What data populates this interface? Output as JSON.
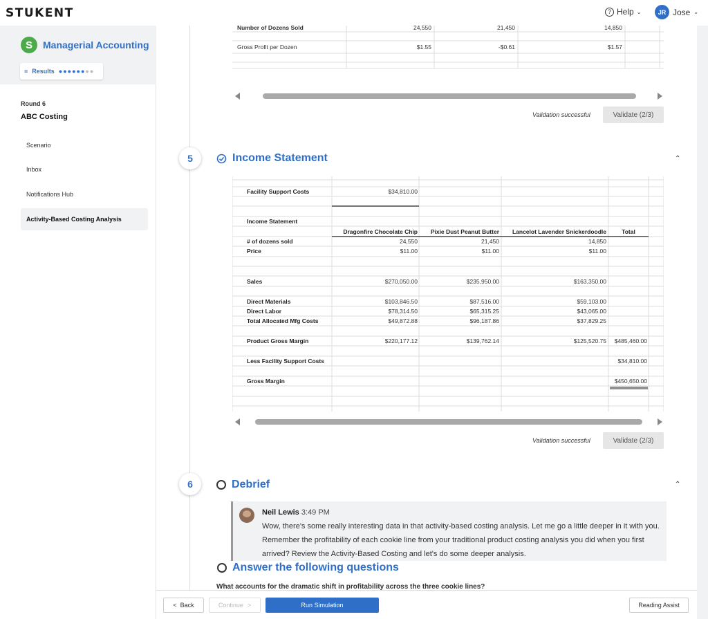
{
  "header": {
    "logo": "STUKENT",
    "help": "Help",
    "user_initials": "JR",
    "user_name": "Jose"
  },
  "sidebar": {
    "course": "Managerial Accounting",
    "course_badge": "S",
    "results": "Results",
    "round": "Round 6",
    "round_name": "ABC Costing",
    "items": [
      {
        "label": "Scenario"
      },
      {
        "label": "Inbox"
      },
      {
        "label": "Notifications Hub"
      },
      {
        "label": "Activity-Based Costing Analysis"
      }
    ]
  },
  "top_table": {
    "rows": [
      {
        "label": "Number of Dozens Sold",
        "values": [
          "24,550",
          "21,450",
          "14,850"
        ]
      },
      {
        "label": "Gross Profit per Dozen",
        "values": [
          "$1.55",
          "-$0.61",
          "$1.57"
        ]
      }
    ],
    "validation": "Validation successful",
    "validate_btn": "Validate (2/3)"
  },
  "step5": {
    "number": "5",
    "title": "Income Statement"
  },
  "income": {
    "facility_label": "Facility Support Costs",
    "facility_value": "$34,810.00",
    "title": "Income Statement",
    "columns": [
      "Dragonfire Chocolate Chip",
      "Pixie Dust Peanut Butter",
      "Lancelot Lavender Snickerdoodle",
      "Total"
    ],
    "rows": [
      {
        "label": "# of dozens sold",
        "values": [
          "24,550",
          "21,450",
          "14,850",
          ""
        ]
      },
      {
        "label": "Price",
        "values": [
          "$11.00",
          "$11.00",
          "$11.00",
          ""
        ]
      },
      {
        "label": "Sales",
        "values": [
          "$270,050.00",
          "$235,950.00",
          "$163,350.00",
          ""
        ]
      },
      {
        "label": "Direct Materials",
        "values": [
          "$103,846.50",
          "$87,516.00",
          "$59,103.00",
          ""
        ]
      },
      {
        "label": "Direct Labor",
        "values": [
          "$78,314.50",
          "$65,315.25",
          "$43,065.00",
          ""
        ]
      },
      {
        "label": "Total Allocated Mfg Costs",
        "values": [
          "$49,872.88",
          "$96,187.86",
          "$37,829.25",
          ""
        ]
      },
      {
        "label": "Product Gross Margin",
        "values": [
          "$220,177.12",
          "$139,762.14",
          "$125,520.75",
          "$485,460.00"
        ]
      },
      {
        "label": "Less Facility Support Costs",
        "values": [
          "",
          "",
          "",
          "$34,810.00"
        ]
      },
      {
        "label": "Gross Margin",
        "values": [
          "",
          "",
          "",
          "$450,650.00"
        ]
      }
    ],
    "validation": "Validation successful",
    "validate_btn": "Validate (2/3)"
  },
  "step6": {
    "number": "6",
    "title": "Debrief"
  },
  "debrief": {
    "name": "Neil Lewis",
    "time": "3:49 PM",
    "message": "Wow, there's some really interesting data in that activity-based costing analysis. Let me go a little deeper in it with you. Remember the profitability of each cookie line from your traditional product costing analysis you did when you first arrived? Review the Activity-Based Costing and let's do some deeper analysis."
  },
  "questions": {
    "title": "Answer the following questions",
    "question1": "What accounts for the dramatic shift in profitability across the three cookie lines?"
  },
  "footer": {
    "back": "Back",
    "continue": "Continue",
    "run": "Run Simulation",
    "reading": "Reading Assist"
  }
}
